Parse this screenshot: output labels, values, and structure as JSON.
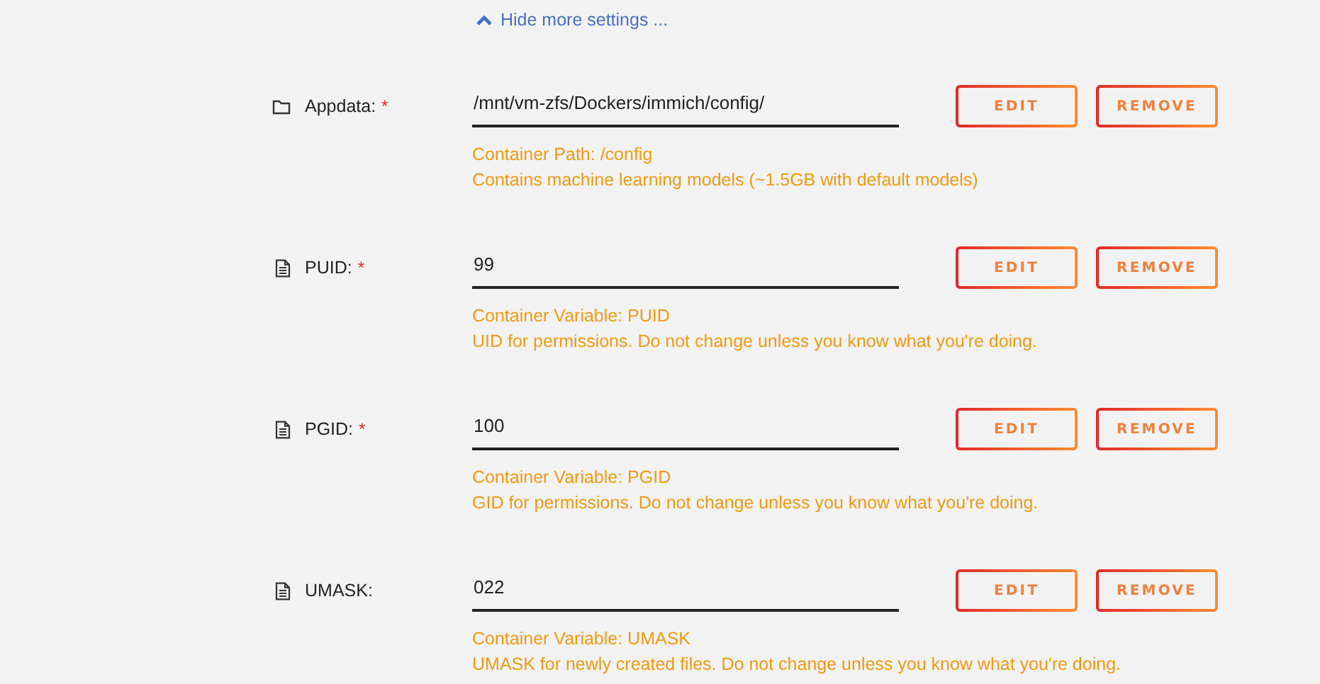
{
  "toggle_link": {
    "label": "Hide more settings ..."
  },
  "settings": [
    {
      "kind": "path",
      "label": "Appdata:",
      "required_mark": "*",
      "value": "/mnt/vm-zfs/Dockers/immich/config/",
      "description": [
        "Container Path: /config",
        "Contains machine learning models (~1.5GB with default models)"
      ],
      "buttons": [
        "EDIT",
        "REMOVE"
      ]
    },
    {
      "kind": "variable",
      "label": "PUID:",
      "required_mark": "*",
      "value": "99",
      "description": [
        "Container Variable: PUID",
        "UID for permissions. Do not change unless you know what you're doing."
      ],
      "buttons": [
        "EDIT",
        "REMOVE"
      ]
    },
    {
      "kind": "variable",
      "label": "PGID:",
      "required_mark": "*",
      "value": "100",
      "description": [
        "Container Variable: PGID",
        "GID for permissions. Do not change unless you know what you're doing."
      ],
      "buttons": [
        "EDIT",
        "REMOVE"
      ]
    },
    {
      "kind": "variable",
      "label": "UMASK:",
      "value": "022",
      "description": [
        "Container Variable: UMASK",
        "UMASK for newly created files. Do not change unless you know what you're doing."
      ],
      "buttons": [
        "EDIT",
        "REMOVE"
      ]
    }
  ]
}
